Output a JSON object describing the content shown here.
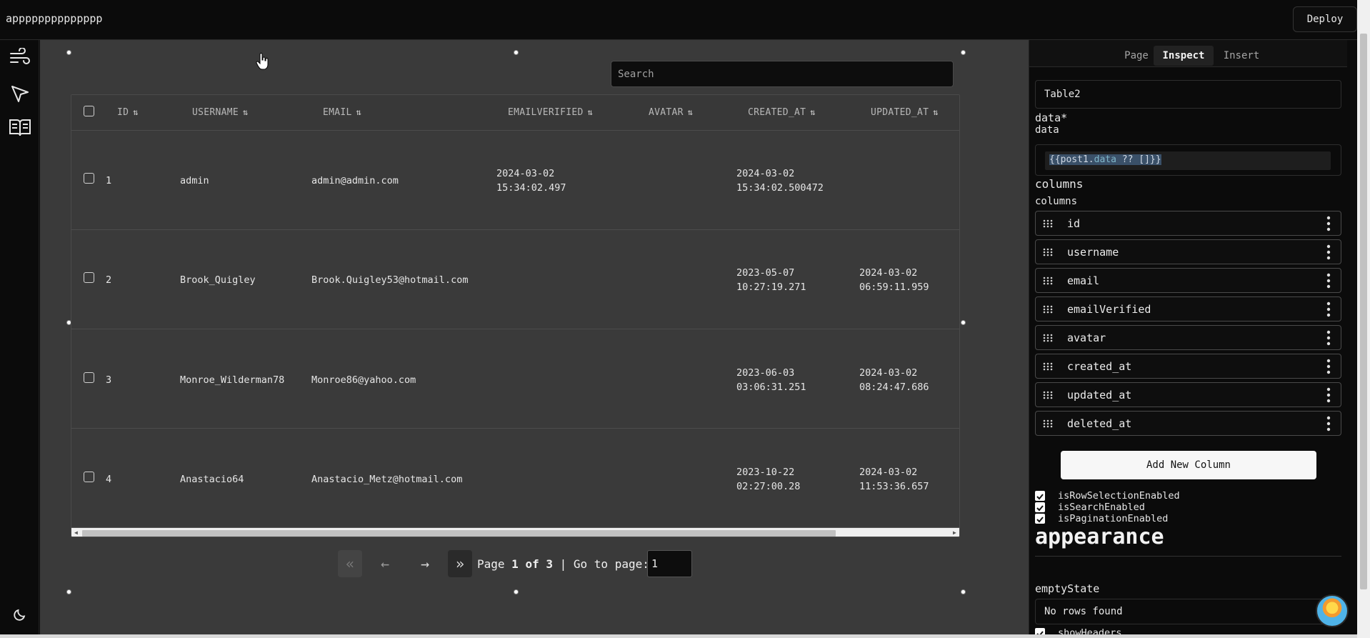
{
  "app": {
    "title": "apppppppppppppp",
    "deploy_label": "Deploy"
  },
  "rail": {
    "icons": [
      "wind-icon",
      "cursor-icon",
      "book-icon",
      "moon-icon"
    ]
  },
  "table": {
    "search_placeholder": "Search",
    "columns": [
      "ID",
      "USERNAME",
      "EMAIL",
      "EMAILVERIFIED",
      "AVATAR",
      "CREATED_AT",
      "UPDATED_AT"
    ],
    "rows": [
      {
        "id": "1",
        "username": "admin",
        "email": "admin@admin.com",
        "emailverified": "2024-03-02\n15:34:02.497",
        "avatar": "",
        "created_at": "2024-03-02\n15:34:02.500472",
        "updated_at": ""
      },
      {
        "id": "2",
        "username": "Brook_Quigley",
        "email": "Brook.Quigley53@hotmail.com",
        "emailverified": "",
        "avatar": "",
        "created_at": "2023-05-07\n10:27:19.271",
        "updated_at": "2024-03-02\n06:59:11.959"
      },
      {
        "id": "3",
        "username": "Monroe_Wilderman78",
        "email": "Monroe86@yahoo.com",
        "emailverified": "",
        "avatar": "",
        "created_at": "2023-06-03\n03:06:31.251",
        "updated_at": "2024-03-02\n08:24:47.686"
      },
      {
        "id": "4",
        "username": "Anastacio64",
        "email": "Anastacio_Metz@hotmail.com",
        "emailverified": "",
        "avatar": "",
        "created_at": "2023-10-22\n02:27:00.28",
        "updated_at": "2024-03-02\n11:53:36.657"
      }
    ]
  },
  "pager": {
    "first_label": "«",
    "prev_label": "←",
    "next_label": "→",
    "last_label": "»",
    "page_word": "Page",
    "page_of": "1 of 3",
    "separator": "|",
    "goto_label": "Go to page:",
    "goto_value": "1"
  },
  "panel": {
    "tabs": [
      "Page",
      "Inspect",
      "Insert"
    ],
    "active_tab": "Inspect",
    "component_name": "Table2",
    "data_heading": "data*",
    "data_sublabel": "data",
    "data_binding_prefix": "{{post1.",
    "data_binding_key": "data",
    "data_binding_suffix": " ?? []}}",
    "columns_heading": "columns",
    "columns_sublabel": "columns",
    "column_items": [
      "id",
      "username",
      "email",
      "emailVerified",
      "avatar",
      "created_at",
      "updated_at",
      "deleted_at"
    ],
    "add_column_label": "Add New Column",
    "flags": [
      "isRowSelectionEnabled",
      "isSearchEnabled",
      "isPaginationEnabled"
    ],
    "appearance_heading": "appearance",
    "empty_state_label": "emptyState",
    "empty_state_value": "No rows found",
    "show_headers_label": "showHeaders"
  }
}
